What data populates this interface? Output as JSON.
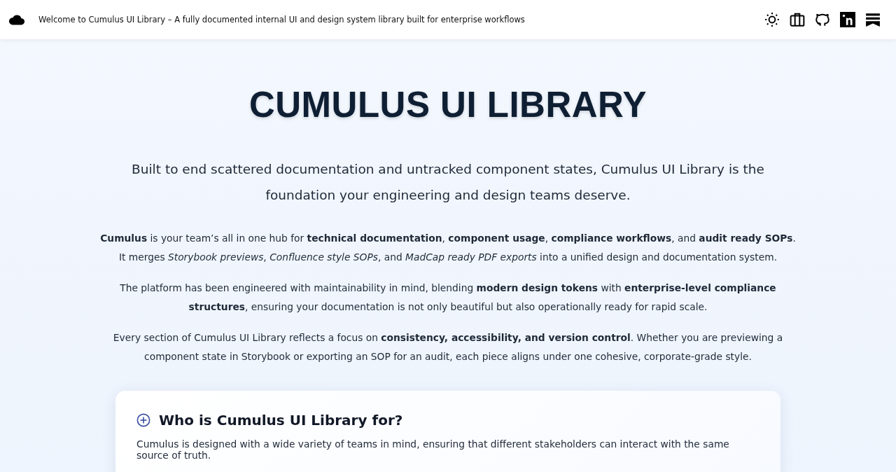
{
  "header": {
    "title": "Welcome to Cumulus UI Library – A fully documented internal UI and design system library built for enterprise workflows"
  },
  "hero": {
    "title": "CUMULUS UI LIBRARY",
    "subtitle": "Built to end scattered documentation and untracked component states, Cumulus UI Library is the foundation your engineering and design teams deserve.",
    "paragraphs": [
      "**Cumulus** is your team’s all in one hub for **technical documentation**, **component usage**, **compliance workflows**, and **audit ready SOPs**. It merges *Storybook previews*, *Confluence style SOPs*, and *MadCap ready PDF exports* into a unified design and documentation system.",
      "The platform has been engineered with maintainability in mind, blending **modern design tokens** with **enterprise-level compliance structures**, ensuring your documentation is not only beautiful but also operationally ready for rapid scale.",
      "Every section of Cumulus UI Library reflects a focus on **consistency, accessibility, and version control**. Whether you are previewing a component state in Storybook or exporting an SOP for an audit, each piece aligns under one cohesive, corporate-grade style."
    ]
  },
  "card": {
    "title": "Who is Cumulus UI Library for?",
    "expanded": false,
    "text": "Cumulus is designed with a wide variety of teams in mind, ensuring that different stakeholders can interact with the same source of truth."
  }
}
